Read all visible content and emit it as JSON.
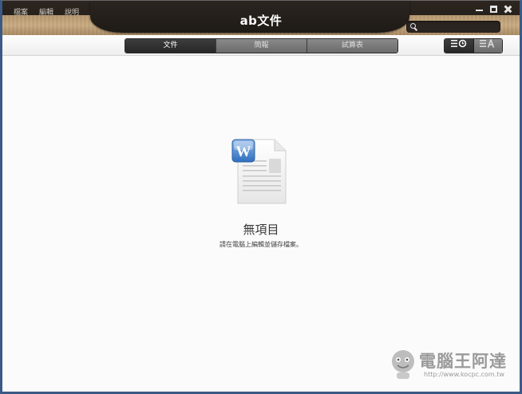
{
  "menu": {
    "items": [
      "檔案",
      "編輯",
      "說明"
    ]
  },
  "app": {
    "title": "ab文件"
  },
  "search": {
    "placeholder": ""
  },
  "tabs": {
    "items": [
      "文件",
      "簡報",
      "試算表"
    ],
    "active": 0
  },
  "view_toggle": {
    "items": [
      "☰◷",
      "☰A"
    ],
    "active": 0
  },
  "empty_state": {
    "title": "無項目",
    "subtitle": "請在電腦上編輯並儲存檔案。",
    "icon": "word-document-icon"
  },
  "watermark": {
    "text": "電腦王阿達",
    "url": "http://www.kocpc.com.tw"
  },
  "colors": {
    "word_blue": "#2e6fbf",
    "accent_dark": "#272727",
    "wood": "#c2a47b"
  }
}
